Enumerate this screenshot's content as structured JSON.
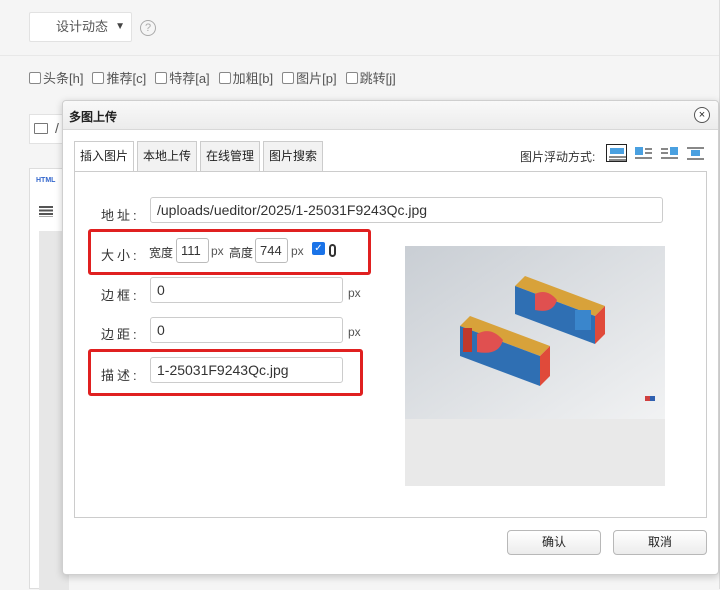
{
  "background": {
    "category_select": "设计动态",
    "help_icon": "?",
    "flags": [
      "头条[h]",
      "推荐[c]",
      "特荐[a]",
      "加粗[b]",
      "图片[p]",
      "跳转[j]"
    ],
    "slash_text": "/",
    "editor_html_label": "HTML"
  },
  "dialog": {
    "title": "多图上传",
    "close_symbol": "×",
    "tabs": [
      {
        "label": "插入图片",
        "active": true
      },
      {
        "label": "本地上传",
        "active": false
      },
      {
        "label": "在线管理",
        "active": false
      },
      {
        "label": "图片搜索",
        "active": false
      }
    ],
    "float_label": "图片浮动方式:",
    "float_options": [
      "none",
      "left",
      "right",
      "center"
    ],
    "form": {
      "address_label": "地址:",
      "address_value": "/uploads/ueditor/2025/1-25031F9243Qc.jpg",
      "size_label": "大小:",
      "width_label": "宽度",
      "width_value": "111",
      "height_label": "高度",
      "height_value": "744",
      "px": "px",
      "lock_ratio_checked": true,
      "border_label": "边框:",
      "border_value": "0",
      "margin_label": "边距:",
      "margin_value": "0",
      "desc_label": "描述:",
      "desc_value": "1-25031F9243Qc.jpg"
    },
    "buttons": {
      "confirm": "确认",
      "cancel": "取消"
    }
  },
  "colors": {
    "highlight_red": "#e02020",
    "checkbox_blue": "#1a73e8",
    "float_icon_blue": "#4aa0e0"
  }
}
